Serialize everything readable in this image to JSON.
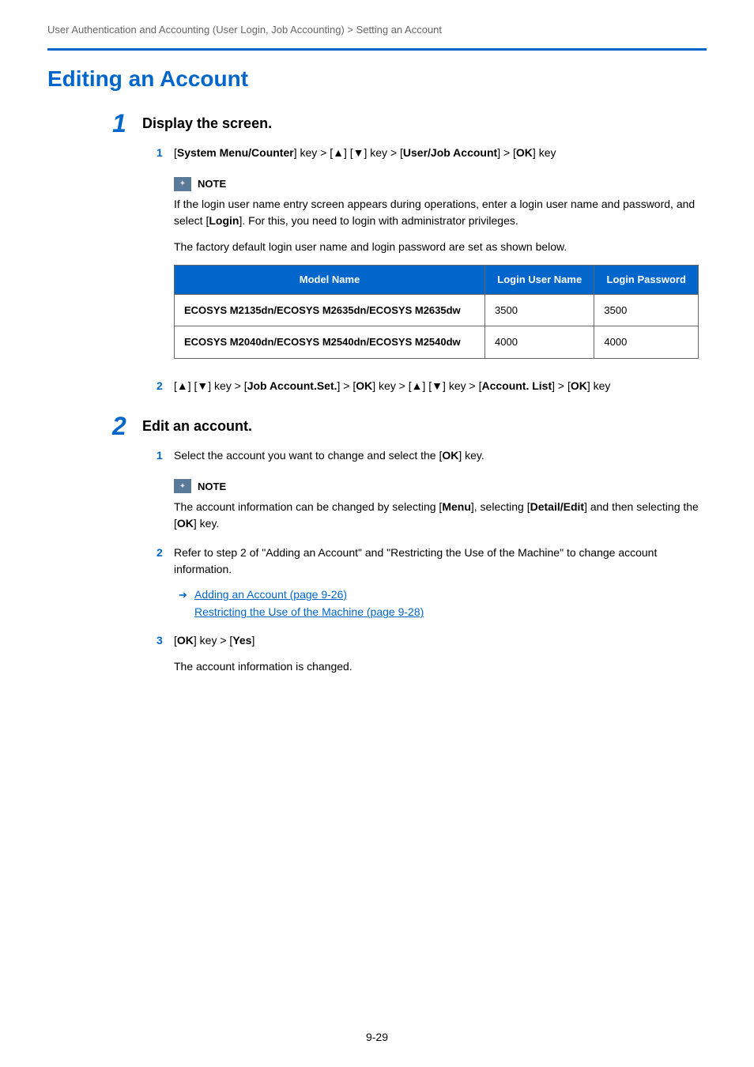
{
  "breadcrumb": "User Authentication and Accounting (User Login, Job Accounting) > Setting an Account",
  "pageTitle": "Editing an Account",
  "step1": {
    "number": "1",
    "title": "Display the screen.",
    "sub1": {
      "num": "1",
      "parts": [
        "[",
        "System Menu/Counter",
        "] key > [▲] [▼] key > [",
        "User/Job Account",
        "] > [",
        "OK",
        "] key"
      ]
    },
    "note": {
      "label": "NOTE",
      "text1a": "If the login user name entry screen appears during operations, enter a login user name and password, and select [",
      "text1b": "Login",
      "text1c": "]. For this, you need to login with administrator privileges.",
      "text2": "The factory default login user name and login password are set as shown below.",
      "table": {
        "headers": [
          "Model Name",
          "Login User Name",
          "Login Password"
        ],
        "rows": [
          [
            "ECOSYS M2135dn/ECOSYS M2635dn/ECOSYS M2635dw",
            "3500",
            "3500"
          ],
          [
            "ECOSYS M2040dn/ECOSYS M2540dn/ECOSYS M2540dw",
            "4000",
            "4000"
          ]
        ]
      }
    },
    "sub2": {
      "num": "2",
      "parts": [
        "[▲] [▼] key > [",
        "Job Account.Set.",
        "] > [",
        "OK",
        "] key > [▲] [▼] key > [",
        "Account. List",
        "] > [",
        "OK",
        "] key"
      ]
    }
  },
  "step2": {
    "number": "2",
    "title": "Edit an account.",
    "sub1": {
      "num": "1",
      "text_a": "Select the account you want to change and select the [",
      "text_b": "OK",
      "text_c": "] key."
    },
    "note": {
      "label": "NOTE",
      "text_a": "The account information can be changed by selecting [",
      "text_b": "Menu",
      "text_c": "], selecting [",
      "text_d": "Detail/Edit",
      "text_e": "] and then selecting the [",
      "text_f": "OK",
      "text_g": "] key."
    },
    "sub2": {
      "num": "2",
      "text": "Refer to step 2 of \"Adding an Account\" and \"Restricting the Use of the Machine\" to change account information.",
      "links": [
        "Adding an Account (page 9-26)",
        "Restricting the Use of the Machine (page 9-28)"
      ]
    },
    "sub3": {
      "num": "3",
      "parts": [
        "[",
        "OK",
        "] key > [",
        "Yes",
        "]"
      ]
    },
    "result": "The account information is changed."
  },
  "pageNumber": "9-29"
}
